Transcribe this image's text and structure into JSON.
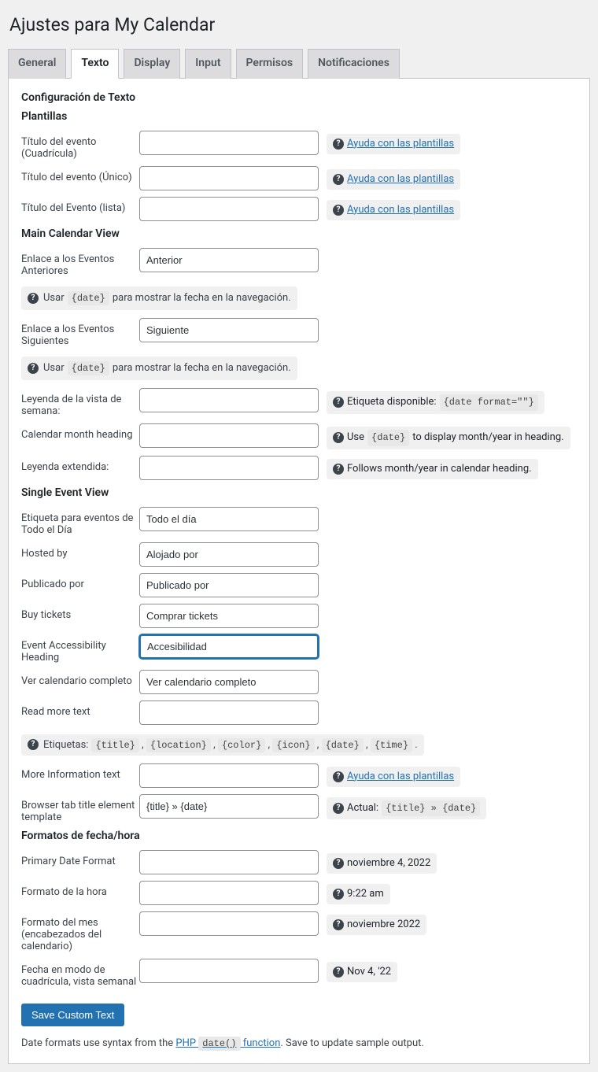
{
  "page_title": "Ajustes para My Calendar",
  "tabs": [
    "General",
    "Texto",
    "Display",
    "Input",
    "Permisos",
    "Notificaciones"
  ],
  "active_tab_index": 1,
  "section_title": "Configuración de Texto",
  "templates": {
    "heading": "Plantillas",
    "title_grid_label": "Título del evento (Cuadrícula)",
    "title_single_label": "Título del evento (Único)",
    "title_list_label": "Título del Evento (lista)",
    "help_link": "Ayuda con las plantillas"
  },
  "main_view": {
    "heading": "Main Calendar View",
    "prev_label": "Enlace a los Eventos Anteriores",
    "prev_value": "Anterior",
    "next_label": "Enlace a los Eventos Siguientes",
    "next_value": "Siguiente",
    "hint_prefix": "Usar ",
    "hint_code": "{date}",
    "hint_suffix": " para mostrar la fecha en la navegación.",
    "week_caption_label": "Leyenda de la vista de semana:",
    "week_tag_prefix": "Etiqueta disponible: ",
    "week_tag_code": "{date format=\"\"}",
    "month_heading_label": "Calendar month heading",
    "month_prefix": "Use ",
    "month_code": "{date}",
    "month_suffix": " to display month/year in heading.",
    "ext_caption_label": "Leyenda extendida:",
    "ext_caption_help": "Follows month/year in calendar heading."
  },
  "single_view": {
    "heading": "Single Event View",
    "all_day_label": "Etiqueta para eventos de Todo el Día",
    "all_day_value": "Todo el día",
    "hosted_label": "Hosted by",
    "hosted_value": "Alojado por",
    "posted_label": "Publicado por",
    "posted_value": "Publicado por",
    "buy_label": "Buy tickets",
    "buy_value": "Comprar tickets",
    "access_label": "Event Accessibility Heading",
    "access_value": "Accesibilidad",
    "view_full_label": "Ver calendario completo",
    "view_full_value": "Ver calendario completo",
    "read_more_label": "Read more text",
    "tags_prefix": "Etiquetas: ",
    "tags_list": "{title} , {location} , {color} , {icon} , {date} , {time} .",
    "more_info_label": "More Information text",
    "more_info_help": "Ayuda con las plantillas",
    "browser_title_label": "Browser tab title element template",
    "browser_title_value": "{title} » {date}",
    "browser_title_prefix": "Actual: ",
    "browser_title_code": "{title} » {date}"
  },
  "date_formats": {
    "heading": "Formatos de fecha/hora",
    "primary_label": "Primary Date Format",
    "primary_sample": "noviembre 4, 2022",
    "time_label": "Formato de la hora",
    "time_sample": "9:22 am",
    "month_label": "Formato del mes (encabezados del calendario)",
    "month_sample": "noviembre 2022",
    "grid_label": "Fecha en modo de cuadrícula, vista semanal",
    "grid_sample": "Nov 4, '22"
  },
  "save_button": "Save Custom Text",
  "footer": {
    "prefix": "Date formats use syntax from the ",
    "link_text_php": "PHP ",
    "link_code": "date()",
    "link_text_suffix": " function",
    "suffix": ". Save to update sample output."
  }
}
